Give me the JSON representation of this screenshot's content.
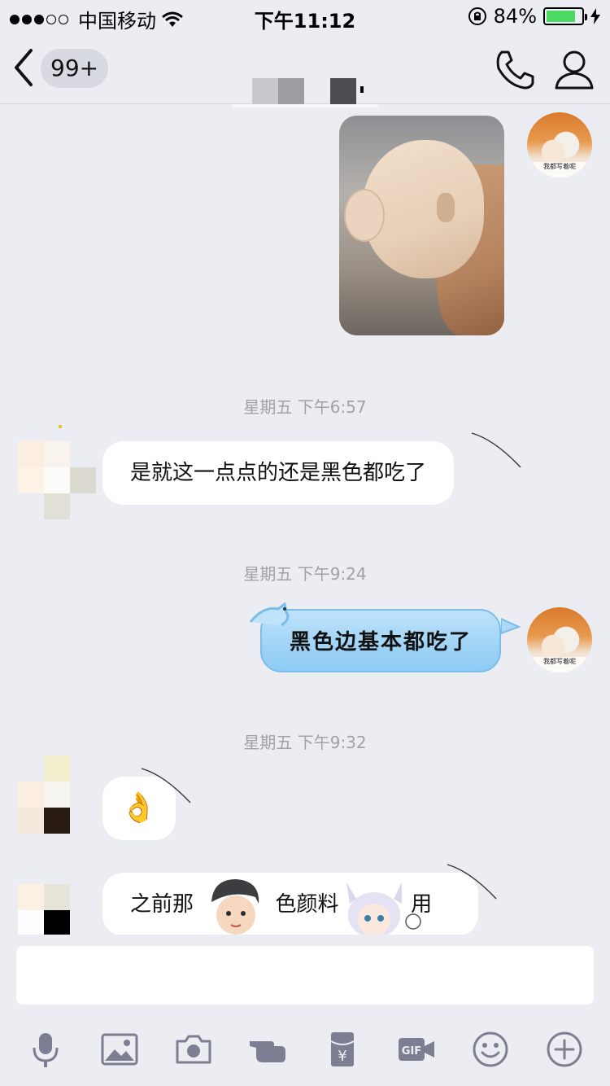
{
  "status_bar": {
    "carrier": "中国移动",
    "time": "下午11:12",
    "battery_percent": "84%",
    "battery_level": 0.84
  },
  "nav": {
    "unread_badge": "99+"
  },
  "chat": {
    "timestamps": [
      "星期五 下午6:57",
      "星期五 下午9:24",
      "星期五 下午9:32"
    ],
    "messages": [
      {
        "from": "self",
        "type": "image"
      },
      {
        "from": "other",
        "type": "text",
        "text": "是就这一点点的还是黑色都吃了"
      },
      {
        "from": "self",
        "type": "text",
        "text": "黑色边基本都吃了"
      },
      {
        "from": "other",
        "type": "emoji",
        "text": "👌"
      },
      {
        "from": "other",
        "type": "text",
        "text": "之前那",
        "text_tail": "色颜料",
        "text_end": "用了"
      }
    ],
    "self_avatar_caption": "我都写着呢"
  },
  "colors": {
    "background": "#ebedf2",
    "self_bubble": "#9fd3f6",
    "timestamp": "#a0a2a8"
  },
  "toolbar": {
    "icons": [
      "microphone-icon",
      "image-icon",
      "camera-icon",
      "poke-hand-icon",
      "red-packet-icon",
      "gif-icon",
      "emoji-icon",
      "plus-icon"
    ],
    "red_packet_symbol": "¥",
    "gif_label": "GIF"
  }
}
